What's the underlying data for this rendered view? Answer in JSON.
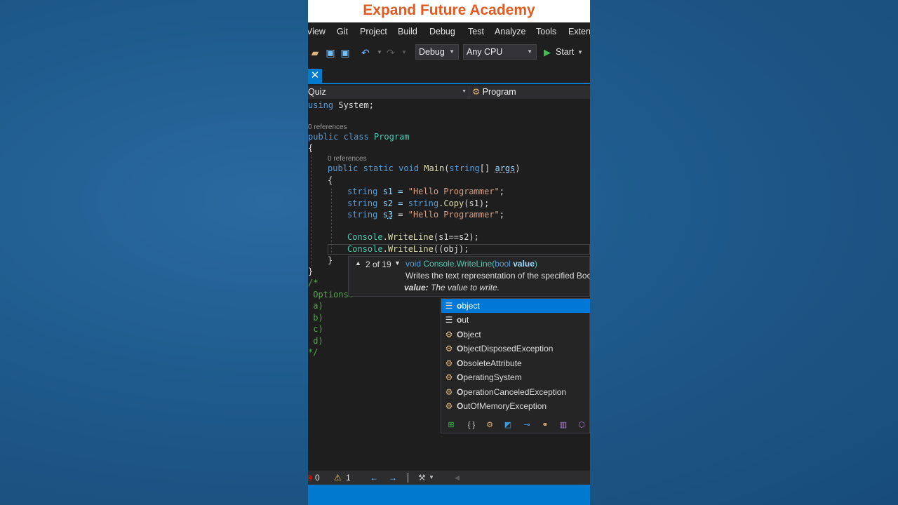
{
  "banner": {
    "title": "Expand Future Academy"
  },
  "menu": [
    "View",
    "Git",
    "Project",
    "Build",
    "Debug",
    "Test",
    "Analyze",
    "Tools",
    "Extens"
  ],
  "toolbar": {
    "config": "Debug",
    "platform": "Any CPU",
    "start": "Start"
  },
  "nav": {
    "left": "Quiz",
    "right": "Program"
  },
  "code": {
    "l1_using": "using",
    "l1_rest": " System;",
    "refs1": "0 references",
    "l2_public": "public",
    "l2_class": "class",
    "l2_name": "Program",
    "brace_open": "{",
    "refs2": "0 references",
    "l3_mods": "public static void",
    "l3_main": "Main",
    "l3_open": "(",
    "l3_string": "string",
    "l3_br": "[] ",
    "l3_args": "args",
    "l3_close": ")",
    "l4_brace": "{",
    "l5_string": "string",
    "l5_var": " s1 = ",
    "l5_str": "\"Hello Programmer\"",
    "l5_end": ";",
    "l6_string": "string",
    "l6_var": " s2 = ",
    "l6_string2": "string",
    "l6_dot": ".",
    "l6_copy": "Copy",
    "l6_end": "(s1);",
    "l7_string": "string",
    "l7_s": " s",
    "l7_3": "3",
    "l7_eq": " = ",
    "l7_str": "\"Hello Programmer\"",
    "l7_end": ";",
    "l8_console": "Console",
    "l8_dot": ".",
    "l8_wl": "WriteLine",
    "l8_end": "(s1==s2);",
    "l9_console": "Console",
    "l9_dot": ".",
    "l9_wl": "WriteLine",
    "l9_end": "((obj);",
    "l10_brace": "}",
    "l11_brace": "}",
    "c1": "/*",
    "c2": " Options:",
    "c3": " a)",
    "c4": " b)",
    "c5": " c)",
    "c6": " d)",
    "c7": "*/"
  },
  "signature": {
    "counter": "2 of 19",
    "ret": "void",
    "owner": "Console.WriteLine(",
    "ptype": "bool",
    "pname": "value",
    "close": ")",
    "desc": "Writes the text representation of the specified Boole",
    "param_label": "value:",
    "param_desc": "The value to write."
  },
  "completion": {
    "items": [
      {
        "bold": "o",
        "rest": "bject",
        "kind": "keyword"
      },
      {
        "bold": "o",
        "rest": "ut",
        "kind": "keyword"
      },
      {
        "bold": "O",
        "rest": "bject",
        "kind": "class"
      },
      {
        "bold": "O",
        "rest": "bjectDisposedException",
        "kind": "class"
      },
      {
        "bold": "O",
        "rest": "bsoleteAttribute",
        "kind": "class"
      },
      {
        "bold": "O",
        "rest": "peratingSystem",
        "kind": "class"
      },
      {
        "bold": "O",
        "rest": "perationCanceledException",
        "kind": "class"
      },
      {
        "bold": "O",
        "rest": "utOfMemoryException",
        "kind": "class"
      }
    ],
    "filters": [
      "snippet-icon",
      "namespace-icon",
      "class-icon",
      "struct-icon",
      "interface-icon",
      "delegate-icon",
      "enum-icon",
      "module-icon"
    ]
  },
  "status": {
    "errors": "0",
    "warnings": "1"
  },
  "colors": {
    "accent": "#007acc",
    "banner_text": "#e05a21",
    "keyword": "#569cd6",
    "type": "#4ec9b0",
    "string": "#d69d85",
    "comment": "#57a64a"
  }
}
